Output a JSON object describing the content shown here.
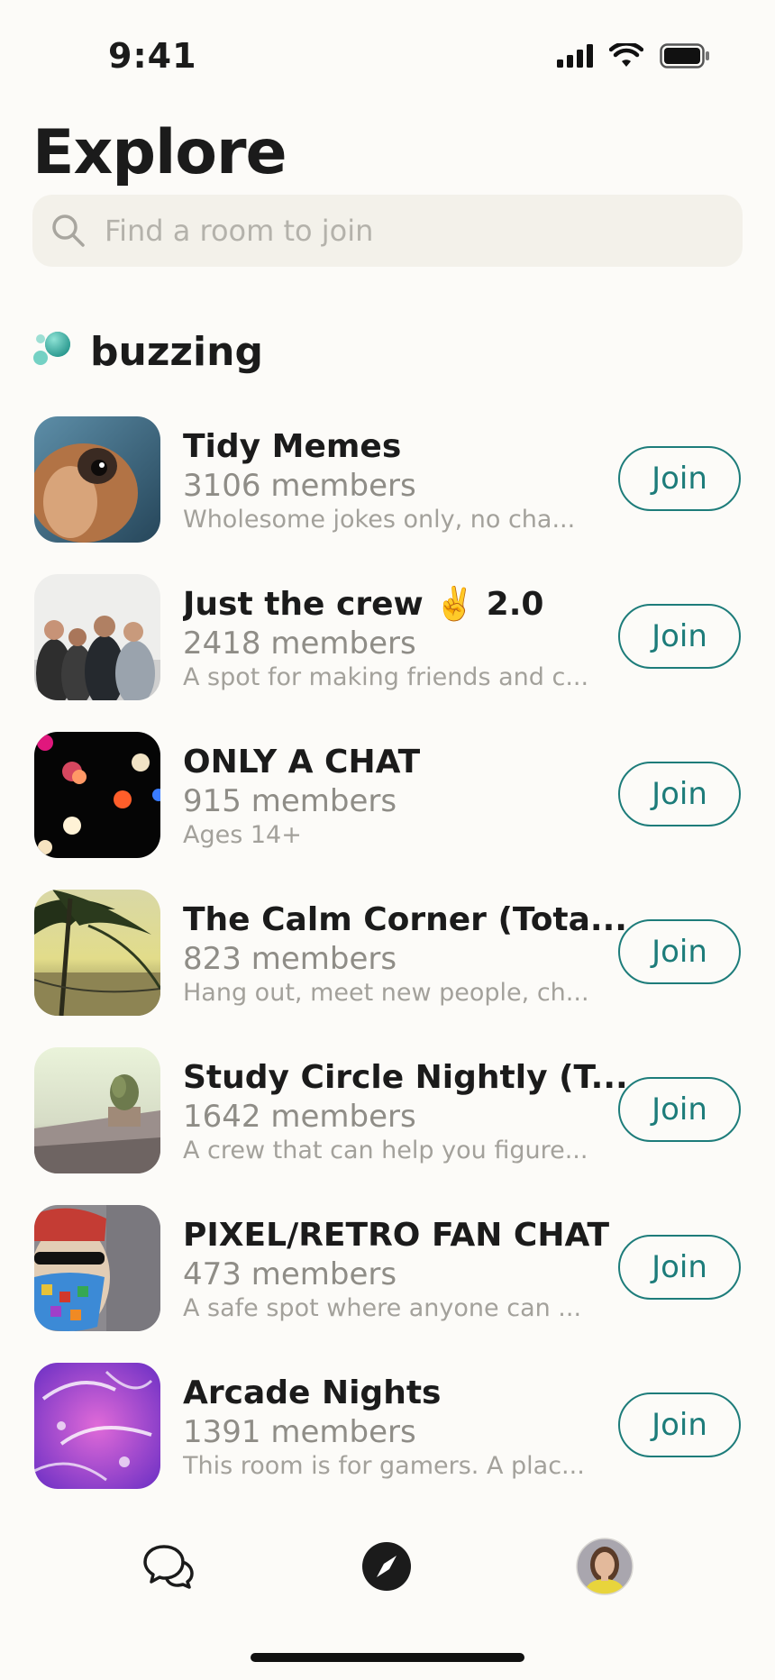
{
  "status_bar": {
    "time": "9:41"
  },
  "page": {
    "title": "Explore"
  },
  "search": {
    "placeholder": "Find a room to join"
  },
  "section": {
    "label": "buzzing",
    "icon": "bubbles-icon",
    "accent_color": "#3fb4a8"
  },
  "rooms": [
    {
      "name": "Tidy Memes",
      "members": "3106 members",
      "description": "Wholesome jokes only, no cha...",
      "join_label": "Join",
      "thumbnail": "puppy-photo"
    },
    {
      "name": "Just the crew ✌️ 2.0",
      "members": "2418 members",
      "description": "A spot for making friends and c...",
      "join_label": "Join",
      "thumbnail": "friends-group-photo"
    },
    {
      "name": "ONLY A CHAT",
      "members": "915 members",
      "description": "Ages 14+",
      "join_label": "Join",
      "thumbnail": "bokeh-lights-photo"
    },
    {
      "name": "The Calm Corner (Tota...",
      "members": "823 members",
      "description": "Hang out, meet new people, ch...",
      "join_label": "Join",
      "thumbnail": "palm-beach-sunset-photo"
    },
    {
      "name": "Study Circle Nightly (T...",
      "members": "1642 members",
      "description": "A crew that can help you figure...",
      "join_label": "Join",
      "thumbnail": "plant-terrace-photo"
    },
    {
      "name": "PIXEL/RETRO FAN CHAT",
      "members": "473 members",
      "description": "A safe spot where anyone can ...",
      "join_label": "Join",
      "thumbnail": "mosaic-beard-man-photo"
    },
    {
      "name": "Arcade Nights",
      "members": "1391 members",
      "description": "This room is for gamers. A plac...",
      "join_label": "Join",
      "thumbnail": "purple-sparkle-photo"
    }
  ],
  "tab_bar": {
    "tabs": [
      {
        "name": "chats",
        "icon": "chat-bubbles-icon",
        "active": false
      },
      {
        "name": "explore",
        "icon": "compass-icon",
        "active": true
      },
      {
        "name": "profile",
        "icon": "avatar",
        "active": false
      }
    ]
  },
  "colors": {
    "accent": "#1d7c7a",
    "background": "#fcfbf8",
    "search_background": "#f3f1ea",
    "secondary_text": "#8f8d87"
  }
}
